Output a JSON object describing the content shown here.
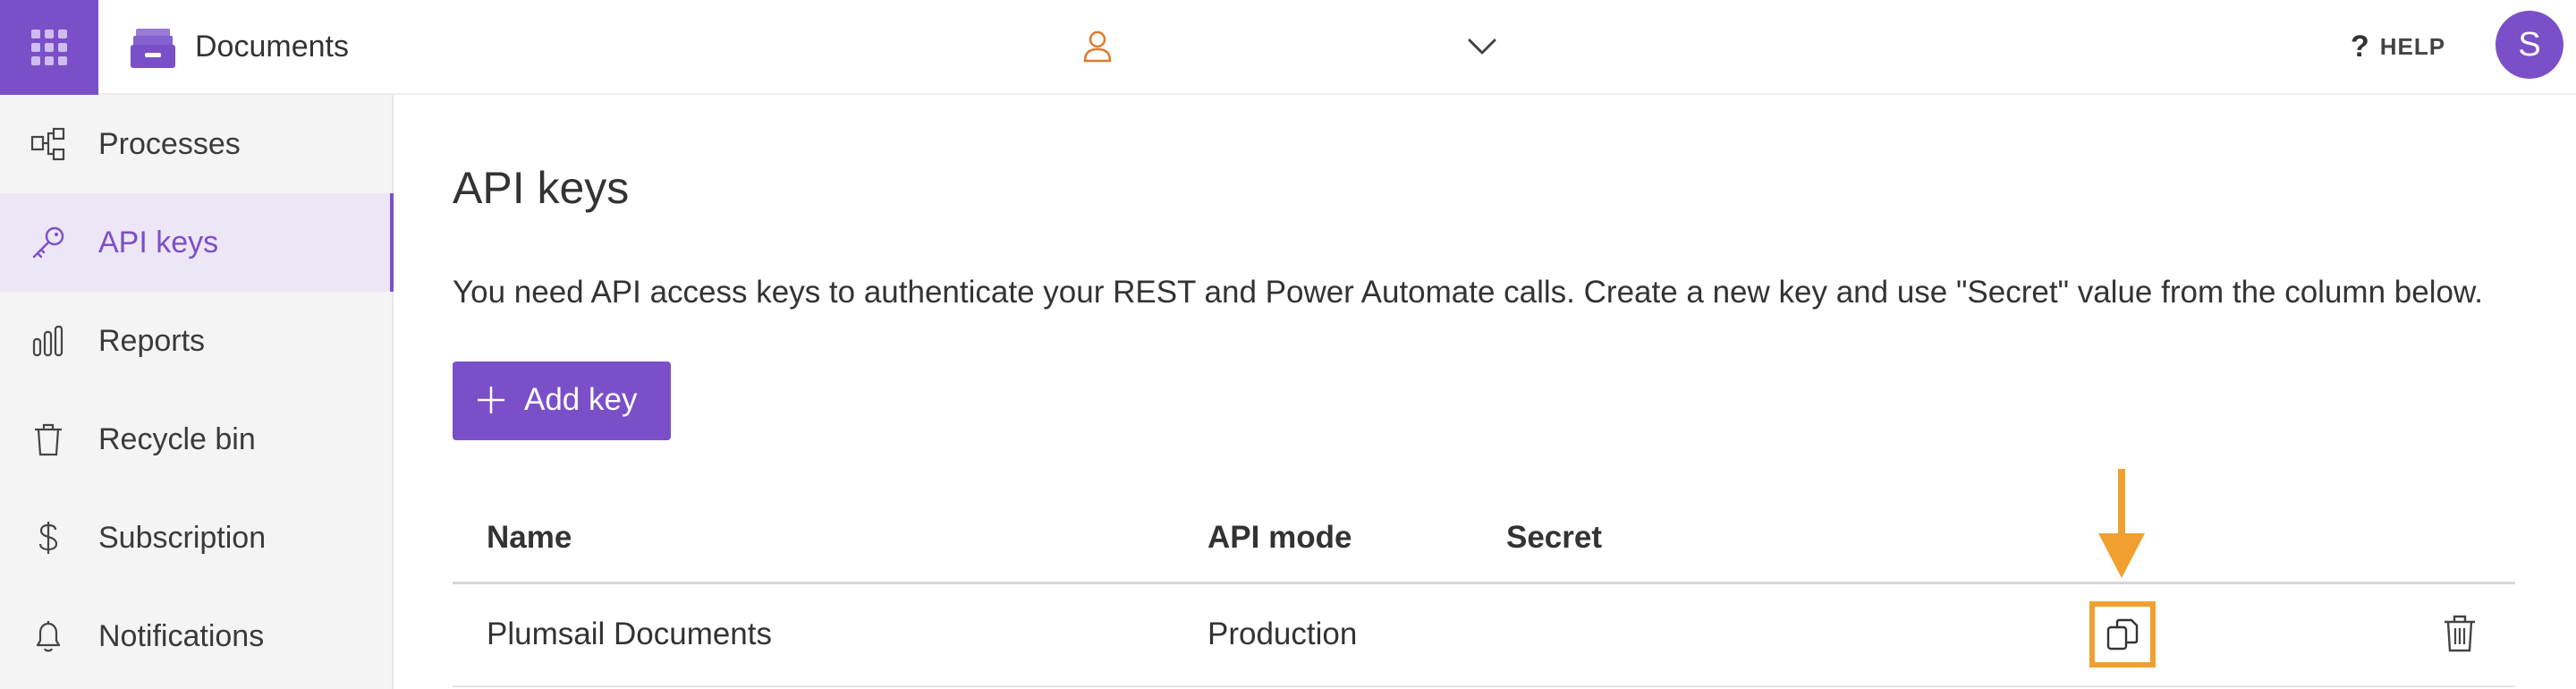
{
  "header": {
    "app_title": "Documents",
    "help_label": "HELP",
    "help_glyph": "?",
    "avatar_initial": "S",
    "accent_color": "#7b4fc8",
    "user_icon_color": "#e07a2c"
  },
  "sidebar": {
    "items": [
      {
        "label": "Processes",
        "icon": "processes-icon",
        "active": false
      },
      {
        "label": "API keys",
        "icon": "key-icon",
        "active": true
      },
      {
        "label": "Reports",
        "icon": "reports-icon",
        "active": false
      },
      {
        "label": "Recycle bin",
        "icon": "trash-icon",
        "active": false
      },
      {
        "label": "Subscription",
        "icon": "dollar-icon",
        "active": false
      },
      {
        "label": "Notifications",
        "icon": "bell-icon",
        "active": false
      }
    ]
  },
  "main": {
    "title": "API keys",
    "description": "You need API access keys to authenticate your REST and Power Automate calls. Create a new key and use \"Secret\" value from the column below.",
    "add_button_label": "Add key",
    "table": {
      "columns": [
        "Name",
        "API mode",
        "Secret"
      ],
      "rows": [
        {
          "name": "Plumsail Documents",
          "api_mode": "Production",
          "secret": ""
        }
      ]
    },
    "highlight_color": "#f0a030"
  }
}
